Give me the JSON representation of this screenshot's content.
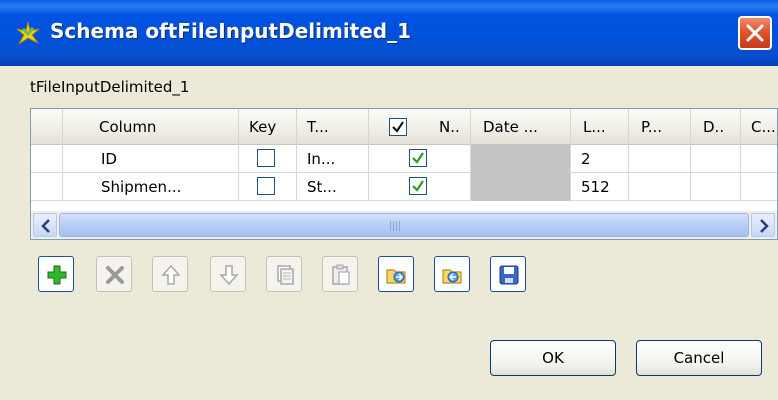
{
  "window": {
    "title": "Schema oftFileInputDelimited_1",
    "subtitle": "tFileInputDelimited_1"
  },
  "table": {
    "headers": [
      "Column",
      "Key",
      "T...",
      "N..",
      "Date ...",
      "L...",
      "P...",
      "D..",
      "C..."
    ],
    "rows": [
      {
        "column": "ID",
        "key": false,
        "type": "In...",
        "nullable": true,
        "length": "2"
      },
      {
        "column": "Shipmen...",
        "key": false,
        "type": "St...",
        "nullable": true,
        "length": "512"
      }
    ]
  },
  "toolbar": {
    "buttons": [
      "add-icon",
      "delete-icon",
      "move-up-icon",
      "move-down-icon",
      "copy-icon",
      "paste-icon",
      "import-icon",
      "export-icon",
      "save-icon"
    ]
  },
  "dialog": {
    "ok_label": "OK",
    "cancel_label": "Cancel"
  },
  "colors": {
    "titlebar": "#0054e3",
    "close": "#e0552e",
    "check": "#21a121",
    "add": "#22aa22",
    "body": "#ece9d8"
  }
}
